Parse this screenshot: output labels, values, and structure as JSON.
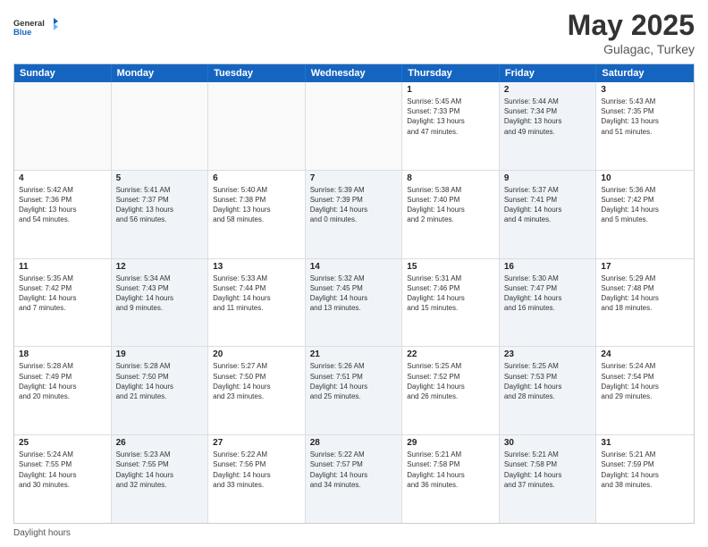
{
  "header": {
    "logo_general": "General",
    "logo_blue": "Blue",
    "month": "May 2025",
    "location": "Gulagac, Turkey"
  },
  "weekdays": [
    "Sunday",
    "Monday",
    "Tuesday",
    "Wednesday",
    "Thursday",
    "Friday",
    "Saturday"
  ],
  "footer_text": "Daylight hours",
  "rows": [
    [
      {
        "day": "",
        "info": "",
        "shaded": false,
        "empty": true
      },
      {
        "day": "",
        "info": "",
        "shaded": false,
        "empty": true
      },
      {
        "day": "",
        "info": "",
        "shaded": false,
        "empty": true
      },
      {
        "day": "",
        "info": "",
        "shaded": false,
        "empty": true
      },
      {
        "day": "1",
        "info": "Sunrise: 5:45 AM\nSunset: 7:33 PM\nDaylight: 13 hours\nand 47 minutes.",
        "shaded": false,
        "empty": false
      },
      {
        "day": "2",
        "info": "Sunrise: 5:44 AM\nSunset: 7:34 PM\nDaylight: 13 hours\nand 49 minutes.",
        "shaded": true,
        "empty": false
      },
      {
        "day": "3",
        "info": "Sunrise: 5:43 AM\nSunset: 7:35 PM\nDaylight: 13 hours\nand 51 minutes.",
        "shaded": false,
        "empty": false
      }
    ],
    [
      {
        "day": "4",
        "info": "Sunrise: 5:42 AM\nSunset: 7:36 PM\nDaylight: 13 hours\nand 54 minutes.",
        "shaded": false,
        "empty": false
      },
      {
        "day": "5",
        "info": "Sunrise: 5:41 AM\nSunset: 7:37 PM\nDaylight: 13 hours\nand 56 minutes.",
        "shaded": true,
        "empty": false
      },
      {
        "day": "6",
        "info": "Sunrise: 5:40 AM\nSunset: 7:38 PM\nDaylight: 13 hours\nand 58 minutes.",
        "shaded": false,
        "empty": false
      },
      {
        "day": "7",
        "info": "Sunrise: 5:39 AM\nSunset: 7:39 PM\nDaylight: 14 hours\nand 0 minutes.",
        "shaded": true,
        "empty": false
      },
      {
        "day": "8",
        "info": "Sunrise: 5:38 AM\nSunset: 7:40 PM\nDaylight: 14 hours\nand 2 minutes.",
        "shaded": false,
        "empty": false
      },
      {
        "day": "9",
        "info": "Sunrise: 5:37 AM\nSunset: 7:41 PM\nDaylight: 14 hours\nand 4 minutes.",
        "shaded": true,
        "empty": false
      },
      {
        "day": "10",
        "info": "Sunrise: 5:36 AM\nSunset: 7:42 PM\nDaylight: 14 hours\nand 5 minutes.",
        "shaded": false,
        "empty": false
      }
    ],
    [
      {
        "day": "11",
        "info": "Sunrise: 5:35 AM\nSunset: 7:42 PM\nDaylight: 14 hours\nand 7 minutes.",
        "shaded": false,
        "empty": false
      },
      {
        "day": "12",
        "info": "Sunrise: 5:34 AM\nSunset: 7:43 PM\nDaylight: 14 hours\nand 9 minutes.",
        "shaded": true,
        "empty": false
      },
      {
        "day": "13",
        "info": "Sunrise: 5:33 AM\nSunset: 7:44 PM\nDaylight: 14 hours\nand 11 minutes.",
        "shaded": false,
        "empty": false
      },
      {
        "day": "14",
        "info": "Sunrise: 5:32 AM\nSunset: 7:45 PM\nDaylight: 14 hours\nand 13 minutes.",
        "shaded": true,
        "empty": false
      },
      {
        "day": "15",
        "info": "Sunrise: 5:31 AM\nSunset: 7:46 PM\nDaylight: 14 hours\nand 15 minutes.",
        "shaded": false,
        "empty": false
      },
      {
        "day": "16",
        "info": "Sunrise: 5:30 AM\nSunset: 7:47 PM\nDaylight: 14 hours\nand 16 minutes.",
        "shaded": true,
        "empty": false
      },
      {
        "day": "17",
        "info": "Sunrise: 5:29 AM\nSunset: 7:48 PM\nDaylight: 14 hours\nand 18 minutes.",
        "shaded": false,
        "empty": false
      }
    ],
    [
      {
        "day": "18",
        "info": "Sunrise: 5:28 AM\nSunset: 7:49 PM\nDaylight: 14 hours\nand 20 minutes.",
        "shaded": false,
        "empty": false
      },
      {
        "day": "19",
        "info": "Sunrise: 5:28 AM\nSunset: 7:50 PM\nDaylight: 14 hours\nand 21 minutes.",
        "shaded": true,
        "empty": false
      },
      {
        "day": "20",
        "info": "Sunrise: 5:27 AM\nSunset: 7:50 PM\nDaylight: 14 hours\nand 23 minutes.",
        "shaded": false,
        "empty": false
      },
      {
        "day": "21",
        "info": "Sunrise: 5:26 AM\nSunset: 7:51 PM\nDaylight: 14 hours\nand 25 minutes.",
        "shaded": true,
        "empty": false
      },
      {
        "day": "22",
        "info": "Sunrise: 5:25 AM\nSunset: 7:52 PM\nDaylight: 14 hours\nand 26 minutes.",
        "shaded": false,
        "empty": false
      },
      {
        "day": "23",
        "info": "Sunrise: 5:25 AM\nSunset: 7:53 PM\nDaylight: 14 hours\nand 28 minutes.",
        "shaded": true,
        "empty": false
      },
      {
        "day": "24",
        "info": "Sunrise: 5:24 AM\nSunset: 7:54 PM\nDaylight: 14 hours\nand 29 minutes.",
        "shaded": false,
        "empty": false
      }
    ],
    [
      {
        "day": "25",
        "info": "Sunrise: 5:24 AM\nSunset: 7:55 PM\nDaylight: 14 hours\nand 30 minutes.",
        "shaded": false,
        "empty": false
      },
      {
        "day": "26",
        "info": "Sunrise: 5:23 AM\nSunset: 7:55 PM\nDaylight: 14 hours\nand 32 minutes.",
        "shaded": true,
        "empty": false
      },
      {
        "day": "27",
        "info": "Sunrise: 5:22 AM\nSunset: 7:56 PM\nDaylight: 14 hours\nand 33 minutes.",
        "shaded": false,
        "empty": false
      },
      {
        "day": "28",
        "info": "Sunrise: 5:22 AM\nSunset: 7:57 PM\nDaylight: 14 hours\nand 34 minutes.",
        "shaded": true,
        "empty": false
      },
      {
        "day": "29",
        "info": "Sunrise: 5:21 AM\nSunset: 7:58 PM\nDaylight: 14 hours\nand 36 minutes.",
        "shaded": false,
        "empty": false
      },
      {
        "day": "30",
        "info": "Sunrise: 5:21 AM\nSunset: 7:58 PM\nDaylight: 14 hours\nand 37 minutes.",
        "shaded": true,
        "empty": false
      },
      {
        "day": "31",
        "info": "Sunrise: 5:21 AM\nSunset: 7:59 PM\nDaylight: 14 hours\nand 38 minutes.",
        "shaded": false,
        "empty": false
      }
    ]
  ]
}
